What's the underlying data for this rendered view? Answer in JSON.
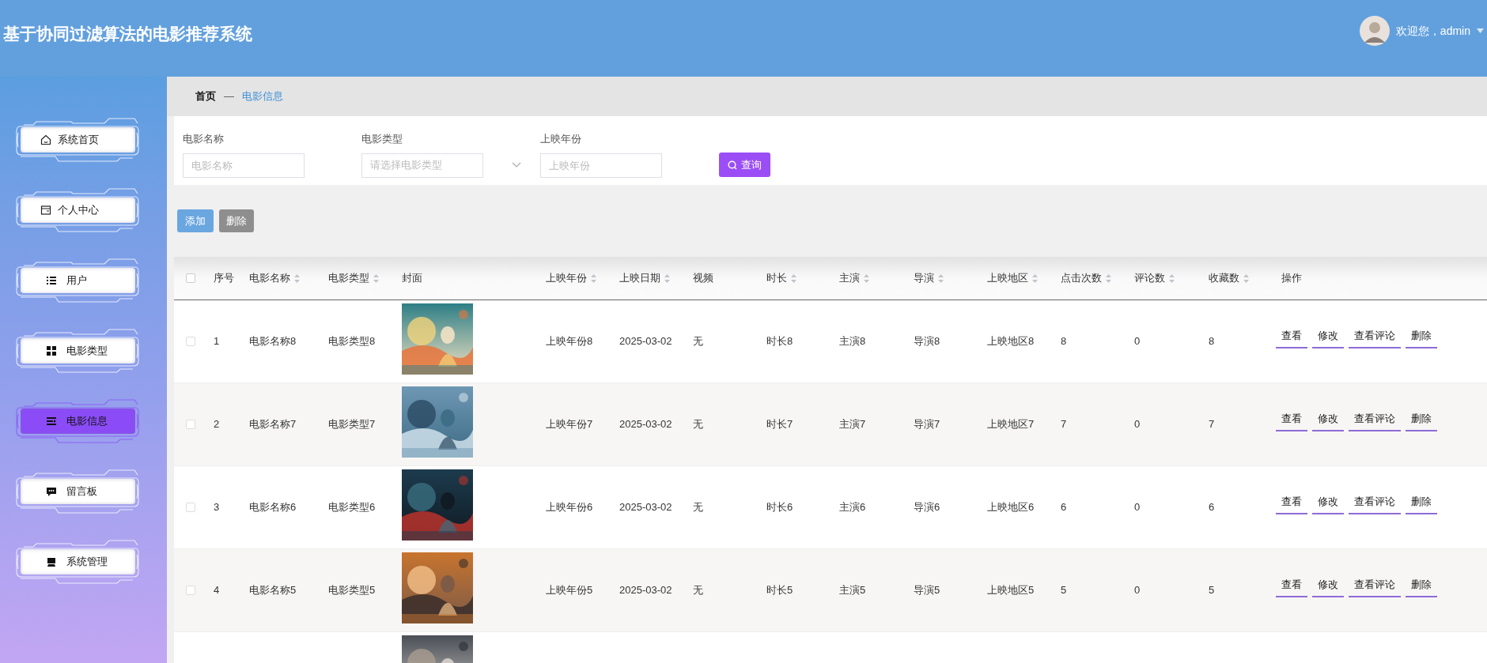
{
  "header": {
    "title": "基于协同过滤算法的电影推荐系统",
    "welcome": "欢迎您，admin"
  },
  "sidebar": {
    "items": [
      {
        "label": "系统首页",
        "selected": false
      },
      {
        "label": "个人中心",
        "selected": false
      },
      {
        "label": "用户",
        "selected": false
      },
      {
        "label": "电影类型",
        "selected": false
      },
      {
        "label": "电影信息",
        "selected": true
      },
      {
        "label": "留言板",
        "selected": false
      },
      {
        "label": "系统管理",
        "selected": false
      }
    ]
  },
  "breadcrumb": {
    "home": "首页",
    "separator": "—",
    "current": "电影信息"
  },
  "search": {
    "fields": [
      {
        "kind": "input",
        "label": "电影名称",
        "placeholder": "电影名称"
      },
      {
        "kind": "select",
        "label": "电影类型",
        "placeholder": "请选择电影类型"
      },
      {
        "kind": "input",
        "label": "上映年份",
        "placeholder": "上映年份"
      }
    ],
    "button": "查询"
  },
  "toolbar": {
    "add": "添加",
    "delete": "删除"
  },
  "table": {
    "all_checked": false,
    "columns": [
      {
        "label": "序号",
        "sortable": false,
        "kind": "text"
      },
      {
        "label": "电影名称",
        "sortable": true,
        "kind": "text"
      },
      {
        "label": "电影类型",
        "sortable": true,
        "kind": "text"
      },
      {
        "label": "封面",
        "sortable": false
      },
      {
        "label": "上映年份",
        "sortable": true,
        "kind": "text"
      },
      {
        "label": "上映日期",
        "sortable": true,
        "kind": "text"
      },
      {
        "label": "视频",
        "sortable": false,
        "kind": "text"
      },
      {
        "label": "时长",
        "sortable": true,
        "kind": "text"
      },
      {
        "label": "主演",
        "sortable": true,
        "kind": "text"
      },
      {
        "label": "导演",
        "sortable": true,
        "kind": "text"
      },
      {
        "label": "上映地区",
        "sortable": true,
        "kind": "text"
      },
      {
        "label": "点击次数",
        "sortable": true,
        "kind": "text"
      },
      {
        "label": "评论数",
        "sortable": true,
        "kind": "text"
      },
      {
        "label": "收藏数",
        "sortable": true,
        "kind": "text"
      },
      {
        "label": "操作",
        "sortable": false,
        "kind": "actions"
      }
    ],
    "rows": [
      {
        "checked": false,
        "cells": [
          "1",
          "电影名称8",
          "电影类型8",
          "上映年份8",
          "2025-03-02",
          "无",
          "时长8",
          "主演8",
          "导演8",
          "上映地区8",
          "8",
          "0",
          "8"
        ],
        "cover": {
          "kind": "picture"
        },
        "actions": [
          "查看",
          "修改",
          "查看评论",
          "删除"
        ]
      },
      {
        "checked": false,
        "cells": [
          "2",
          "电影名称7",
          "电影类型7",
          "上映年份7",
          "2025-03-02",
          "无",
          "时长7",
          "主演7",
          "导演7",
          "上映地区7",
          "7",
          "0",
          "7"
        ],
        "cover": {
          "kind": "picture"
        },
        "actions": [
          "查看",
          "修改",
          "查看评论",
          "删除"
        ]
      },
      {
        "checked": false,
        "cells": [
          "3",
          "电影名称6",
          "电影类型6",
          "上映年份6",
          "2025-03-02",
          "无",
          "时长6",
          "主演6",
          "导演6",
          "上映地区6",
          "6",
          "0",
          "6"
        ],
        "cover": {
          "kind": "picture"
        },
        "actions": [
          "查看",
          "修改",
          "查看评论",
          "删除"
        ]
      },
      {
        "checked": false,
        "cells": [
          "4",
          "电影名称5",
          "电影类型5",
          "上映年份5",
          "2025-03-02",
          "无",
          "时长5",
          "主演5",
          "导演5",
          "上映地区5",
          "5",
          "0",
          "5"
        ],
        "cover": {
          "kind": "picture"
        },
        "actions": [
          "查看",
          "修改",
          "查看评论",
          "删除"
        ]
      },
      {
        "cover": {
          "kind": "picture"
        }
      }
    ]
  }
}
